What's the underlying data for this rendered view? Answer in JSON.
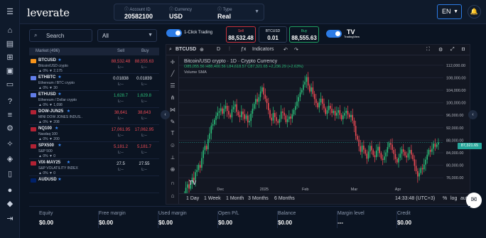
{
  "app": {
    "logo_text": "leverate",
    "brand_color": "#2c7be5"
  },
  "header": {
    "account_id_label": "Account ID",
    "account_id": "20582100",
    "currency_label": "Currency",
    "currency": "USD",
    "type_label": "Type",
    "type": "Real",
    "language": "EN"
  },
  "rail_icons": [
    "menu-icon",
    "home-icon",
    "portfolio-icon",
    "bank-icon",
    "wallet-icon",
    "cards-icon",
    "help-icon",
    "news-icon",
    "settings-icon",
    "lightbulb-icon",
    "shield-icon",
    "book-icon",
    "apple-icon",
    "android-icon",
    "logout-icon"
  ],
  "market": {
    "search_placeholder": "Search",
    "filter_value": "All",
    "col_market": "Market (496)",
    "col_sell": "Sell",
    "col_buy": "Buy",
    "rows": [
      {
        "symbol": "BTCUSD",
        "desc": "Bitcoin/USD crypto",
        "chg": "▲ 0%  ▼ 2,175",
        "sell": "88,532.48",
        "buy": "88,555.63",
        "sell_color": "#ef4b55",
        "buy_color": "#ef4b55",
        "flag": "#f7931a"
      },
      {
        "symbol": "ETHBTC",
        "desc": "Ethereum / BTC crypto",
        "chg": "▲ 0%  ▼ 30",
        "sell": "0.01838",
        "buy": "0.01839",
        "sell_color": "#e3e8f0",
        "buy_color": "#e3e8f0",
        "flag": "#627eea"
      },
      {
        "symbol": "ETHUSD",
        "desc": "Ethereum / Dollar crypto",
        "chg": "▲ 0%  ▼ 1,098",
        "sell": "1,628.7",
        "buy": "1,629.8",
        "sell_color": "#2bbf7a",
        "buy_color": "#2bbf7a",
        "flag": "#627eea"
      },
      {
        "symbol": "DOW-JUN25",
        "desc": "MINI DOW JONES INDUS..",
        "chg": "▲ 0%  ▼ 208",
        "sell": "38,641",
        "buy": "38,643",
        "sell_color": "#ef4b55",
        "buy_color": "#ef4b55",
        "flag": "#b22234"
      },
      {
        "symbol": "NQ100",
        "desc": "Nasdaq 100",
        "chg": "▲ 0%  ▼ 200",
        "sell": "17,061.95",
        "buy": "17,062.95",
        "sell_color": "#ef4b55",
        "buy_color": "#ef4b55",
        "flag": "#b22234"
      },
      {
        "symbol": "SPX500",
        "desc": "S&P 500",
        "chg": "▲ 0%  ▼ 0",
        "sell": "5,181.2",
        "buy": "5,181.7",
        "sell_color": "#ef4b55",
        "buy_color": "#ef4b55",
        "flag": "#b22234"
      },
      {
        "symbol": "VIX-MAY25",
        "desc": "S&P VOLATILITY INDEX",
        "chg": "▲ 0%  ▼ 0",
        "sell": "27.5",
        "buy": "27.55",
        "sell_color": "#e3e8f0",
        "buy_color": "#e3e8f0",
        "flag": "#b22234"
      },
      {
        "symbol": "AUDUSD",
        "desc": "",
        "chg": "",
        "sell": "",
        "buy": "",
        "sell_color": "#e3e8f0",
        "buy_color": "#e3e8f0",
        "flag": "#012169"
      }
    ]
  },
  "trade": {
    "one_click": "1-Click Trading",
    "sell_label": "Sell",
    "sell_price": "88,532.48",
    "symbol": "BTCUSD",
    "lot": "0.01",
    "buy_label": "Buy",
    "buy_price": "88,555.63",
    "tv_name": "TradingView"
  },
  "chart_toolbar": {
    "symbol": "BTCUSD",
    "interval": "D",
    "indicators": "Indicators"
  },
  "chart_info": {
    "title": "Bitcoin/USD crypto · 1D · Crypto Currency",
    "ohlc": "O85,055.56 H88,400.56 L84,618.57 C87,321.65 +2,236.29 (+2.63%)",
    "volume": "Volume SMA",
    "last_price": "87,321.65",
    "up_color": "#2bbf7a",
    "down_color": "#ef4b55"
  },
  "chart_data": {
    "type": "candlestick",
    "x_ticks": [
      "Dec",
      "2025",
      "Feb",
      "Mar",
      "Apr"
    ],
    "y_ticks": [
      112000,
      108000,
      104000,
      100000,
      96000,
      92000,
      88000,
      84000,
      80000,
      76000
    ],
    "ylim": [
      74000,
      114000
    ],
    "start_price": 69500,
    "closes": [
      69500,
      70400,
      72800,
      73900,
      72500,
      74100,
      76000,
      75200,
      77800,
      78500,
      80100,
      79200,
      82300,
      84800,
      86200,
      85100,
      88400,
      90200,
      92700,
      93100,
      94500,
      95800,
      96800,
      97300,
      98200,
      96500,
      98100,
      99000,
      97400,
      96200,
      95300,
      97900,
      98700,
      99500,
      97100,
      96000,
      95400,
      97200,
      96300,
      94800,
      95900,
      93700,
      94200,
      96500,
      98100,
      99600,
      101200,
      100300,
      101800,
      103600,
      104900,
      102600,
      101300,
      99900,
      97600,
      95200,
      94300,
      96700,
      95400,
      94100,
      93600,
      94800,
      97200,
      96800,
      95900,
      93800,
      94700,
      95600,
      94900,
      96300,
      97700,
      98900,
      100400,
      101800,
      103300,
      104100,
      105800,
      106700,
      108200,
      105500,
      103600,
      104900,
      102800,
      101200,
      99900,
      98500,
      100100,
      101300,
      99700,
      98200,
      96400,
      97600,
      99000,
      98100,
      96700,
      97400,
      95900,
      96800,
      97600,
      96100,
      94700,
      95900,
      96700,
      97400,
      96200,
      95400,
      96100,
      94300,
      92600,
      89400,
      88200,
      86100,
      84300,
      86300,
      85000,
      83700,
      82100,
      84400,
      86200,
      84800,
      83200,
      82600,
      84700,
      85900,
      83900,
      82100,
      81700,
      82800,
      84100,
      85800,
      87100,
      86600,
      84900,
      83600,
      82000,
      80900,
      82400,
      83700,
      85100,
      84300,
      83100,
      82500,
      83800,
      84900,
      83400,
      81900,
      79800,
      78100,
      76400,
      77500,
      79100,
      78700,
      80200,
      81800,
      83400,
      84900,
      84300,
      85300,
      86900,
      85900,
      86600,
      87321.65
    ]
  },
  "timeframes": [
    "1 Day",
    "1 Week",
    "1 Month",
    "3 Months",
    "6 Months"
  ],
  "chart_status": {
    "time": "14:33:48 (UTC+3)",
    "pct": "%",
    "log": "log",
    "auto": "auto"
  },
  "summary": [
    {
      "label": "Equity",
      "value": "$0.00"
    },
    {
      "label": "Free margin",
      "value": "$0.00"
    },
    {
      "label": "Used margin",
      "value": "$0.00"
    },
    {
      "label": "Open P/L",
      "value": "$0.00"
    },
    {
      "label": "Balance",
      "value": "$0.00"
    },
    {
      "label": "Margin level",
      "value": "---"
    },
    {
      "label": "Credit",
      "value": "$0.00"
    }
  ]
}
